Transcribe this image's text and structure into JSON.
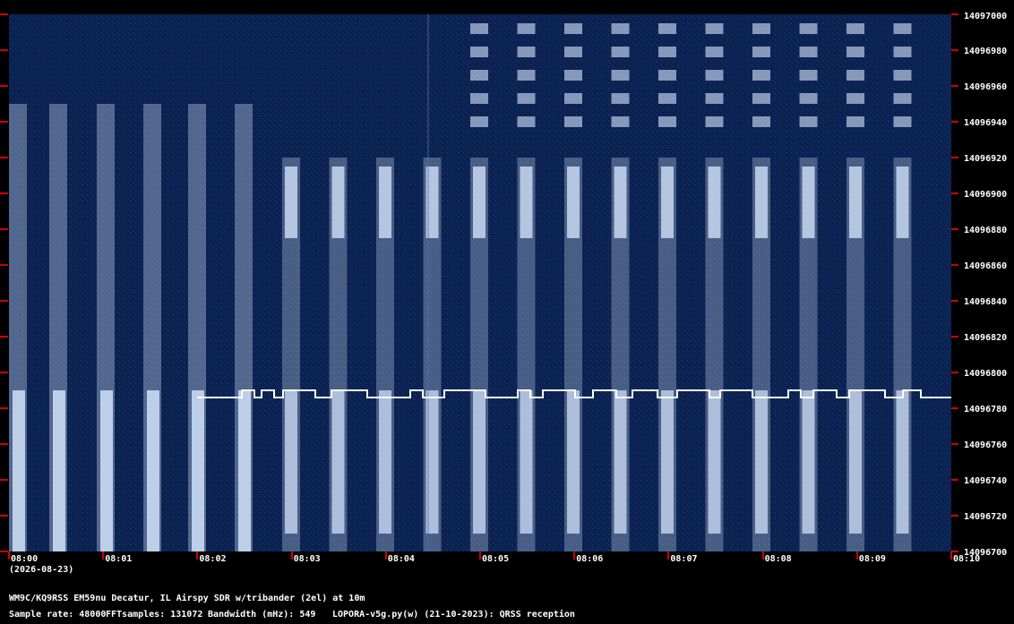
{
  "colors": {
    "background": "#000000",
    "plot": "#0b2150",
    "signal": "#d8e8ff",
    "trace": "#ffffff",
    "tick": "#d00000"
  },
  "y_axis": {
    "labels": [
      "14097000",
      "14096980",
      "14096960",
      "14096940",
      "14096920",
      "14096900",
      "14096880",
      "14096860",
      "14096840",
      "14096820",
      "14096800",
      "14096780",
      "14096760",
      "14096740",
      "14096720",
      "14096700"
    ]
  },
  "x_axis": {
    "labels": [
      "08:00",
      "08:01",
      "08:02",
      "08:03",
      "08:04",
      "08:05",
      "08:06",
      "08:07",
      "08:08",
      "08:09",
      "08:10"
    ],
    "date": "(2026-08-23)"
  },
  "info": {
    "station": "WM9C/KQ9RSS EM59nu Decatur, IL  Airspy SDR w/tribander (2el) at 10m",
    "sample_rate": "Sample rate: 48000",
    "fft_samples": "FFTsamples: 131072",
    "bandwidth": "Bandwidth (mHz): 549",
    "software": "LOPORA-v5g.py(w) (21-10-2023): QRSS reception"
  }
}
